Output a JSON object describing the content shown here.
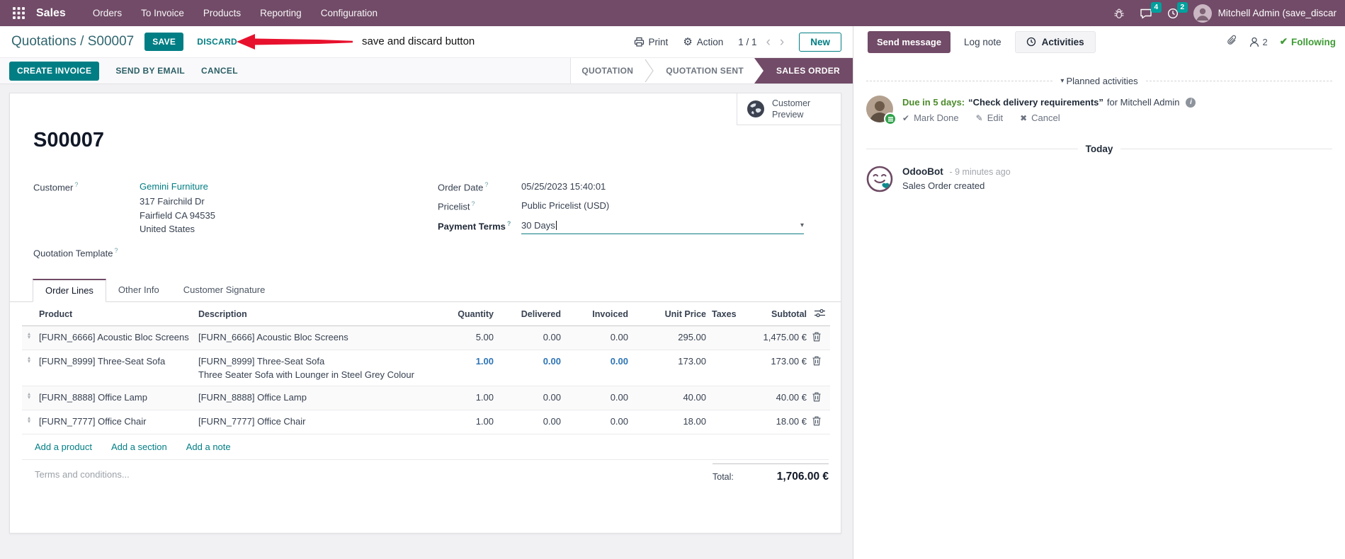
{
  "help_q": "?",
  "icons": {
    "gear": "⚙",
    "caret_down": "▾",
    "prev": "‹",
    "next": "›",
    "check": "✔",
    "pencil": "✎",
    "cross": "✖",
    "drag_up": "▴",
    "drag_down": "▾",
    "info": "i"
  },
  "topbar": {
    "app_name": "Sales",
    "menus": {
      "orders": "Orders",
      "to_invoice": "To Invoice",
      "products": "Products",
      "reporting": "Reporting",
      "configuration": "Configuration"
    },
    "message_count": "4",
    "activity_count": "2",
    "user_name": "Mitchell Admin (save_discar"
  },
  "control": {
    "breadcrumb": "Quotations / S00007",
    "save": "SAVE",
    "discard": "DISCARD",
    "print": "Print",
    "action": "Action",
    "pager": "1 / 1",
    "new": "New"
  },
  "annotation": {
    "text": "save and discard button"
  },
  "statusbar": {
    "create_invoice": "CREATE INVOICE",
    "send_by_email": "SEND BY EMAIL",
    "cancel": "CANCEL",
    "steps": {
      "quotation": "QUOTATION",
      "quotation_sent": "QUOTATION SENT",
      "sales_order": "SALES ORDER"
    }
  },
  "sheet": {
    "preview_button": "Customer Preview",
    "title": "S00007",
    "customer_label": "Customer",
    "customer_name": "Gemini Furniture",
    "address1": "317 Fairchild Dr",
    "address2": "Fairfield CA 94535",
    "address3": "United States",
    "quotation_template_label": "Quotation Template",
    "order_date_label": "Order Date",
    "order_date": "05/25/2023 15:40:01",
    "pricelist_label": "Pricelist",
    "pricelist": "Public Pricelist (USD)",
    "payment_terms_label": "Payment Terms",
    "payment_terms": "30 Days",
    "tabs": {
      "order_lines": "Order Lines",
      "other_info": "Other Info",
      "customer_signature": "Customer Signature"
    },
    "columns": {
      "product": "Product",
      "description": "Description",
      "quantity": "Quantity",
      "delivered": "Delivered",
      "invoiced": "Invoiced",
      "unit_price": "Unit Price",
      "taxes": "Taxes",
      "subtotal": "Subtotal"
    },
    "rows": [
      {
        "product": "[FURN_6666] Acoustic Bloc Screens",
        "description": "[FURN_6666] Acoustic Bloc Screens",
        "description2": "",
        "quantity": "5.00",
        "delivered": "0.00",
        "invoiced": "0.00",
        "unit_price": "295.00",
        "taxes": "",
        "subtotal": "1,475.00 €"
      },
      {
        "product": "[FURN_8999] Three-Seat Sofa",
        "description": "[FURN_8999] Three-Seat Sofa",
        "description2": "Three Seater Sofa with Lounger in Steel Grey Colour",
        "quantity": "1.00",
        "delivered": "0.00",
        "invoiced": "0.00",
        "unit_price": "173.00",
        "taxes": "",
        "subtotal": "173.00 €"
      },
      {
        "product": "[FURN_8888] Office Lamp",
        "description": "[FURN_8888] Office Lamp",
        "description2": "",
        "quantity": "1.00",
        "delivered": "0.00",
        "invoiced": "0.00",
        "unit_price": "40.00",
        "taxes": "",
        "subtotal": "40.00 €"
      },
      {
        "product": "[FURN_7777] Office Chair",
        "description": "[FURN_7777] Office Chair",
        "description2": "",
        "quantity": "1.00",
        "delivered": "0.00",
        "invoiced": "0.00",
        "unit_price": "18.00",
        "taxes": "",
        "subtotal": "18.00 €"
      }
    ],
    "add_product": "Add a product",
    "add_section": "Add a section",
    "add_note": "Add a note",
    "terms_placeholder": "Terms and conditions...",
    "total_label": "Total:",
    "total_value": "1,706.00 €"
  },
  "chatter": {
    "send_message": "Send message",
    "log_note": "Log note",
    "activities": "Activities",
    "followers_count": "2",
    "following": "Following",
    "planned_header": "Planned activities",
    "activity": {
      "due": "Due in 5 days:",
      "title": "“Check delivery requirements”",
      "assignee": "for Mitchell Admin",
      "mark_done": "Mark Done",
      "edit": "Edit",
      "cancel": "Cancel"
    },
    "today": "Today",
    "message": {
      "author": "OdooBot",
      "time": "- 9 minutes ago",
      "body": "Sales Order created"
    }
  },
  "colors": {
    "brand_purple": "#714B67",
    "accent_teal": "#017e84",
    "badge_teal": "#00a09d",
    "modified_blue": "#2e75b6",
    "success_green": "#4c8b2b",
    "annotation_red": "#e8112d"
  }
}
